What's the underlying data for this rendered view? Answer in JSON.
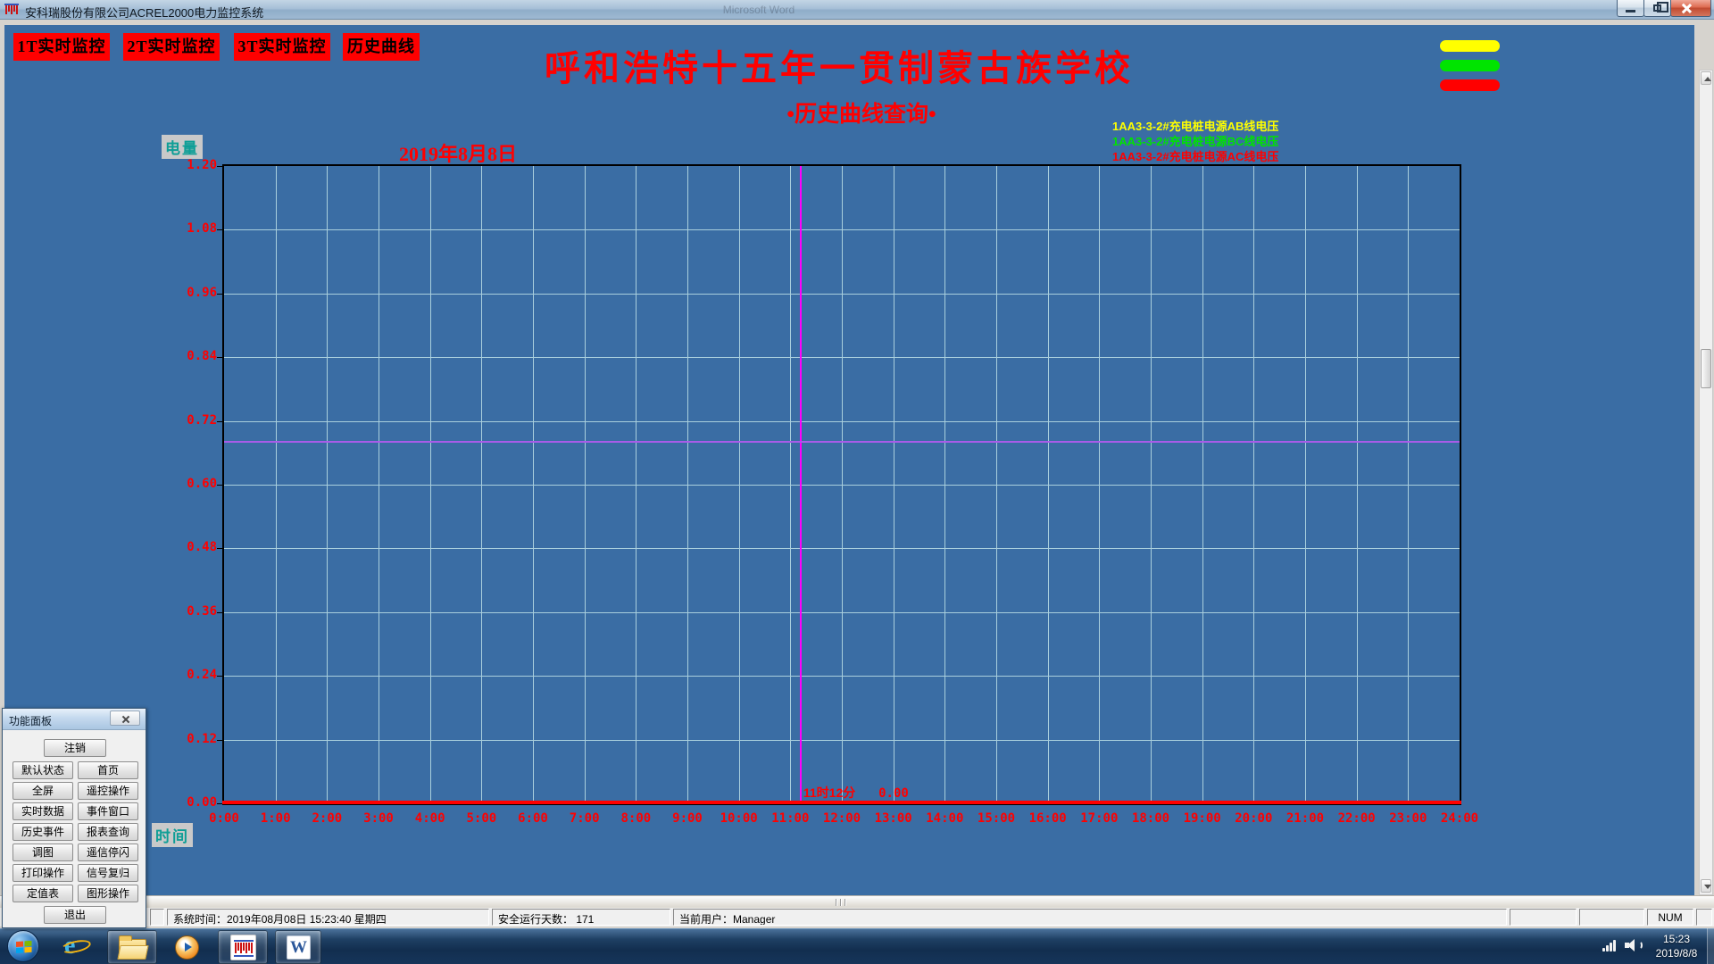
{
  "theme": {
    "background_blue": "#3A6DA4",
    "accent_red": "#FF0000",
    "grid_color": "#A9CFDD",
    "label_teal": "#0E9E96",
    "crosshair_magenta": "#FF00FF",
    "crosshair_violet": "#A85CE8"
  },
  "window": {
    "title": "安科瑞股份有限公司ACREL2000电力监控系统",
    "background_window_hint": "Microsoft Word"
  },
  "nav": {
    "buttons": [
      {
        "label": "1T实时监控"
      },
      {
        "label": "2T实时监控"
      },
      {
        "label": "3T实时监控"
      },
      {
        "label": "历史曲线"
      }
    ]
  },
  "header": {
    "school_title": "呼和浩特十五年一贯制蒙古族学校",
    "page_subtitle": "•历史曲线查询•"
  },
  "legend": {
    "items": [
      {
        "label": "1AA3-3-2#充电桩电源AB线电压",
        "color": "#FFFF00"
      },
      {
        "label": "1AA3-3-2#充电桩电源BC线电压",
        "color": "#00E400"
      },
      {
        "label": "1AA3-3-2#充电桩电源AC线电压",
        "color": "#FF0000"
      }
    ]
  },
  "indicator_pills": [
    {
      "color": "#FFFF00"
    },
    {
      "color": "#00E400"
    },
    {
      "color": "#FF0000"
    }
  ],
  "chart_data": {
    "type": "line",
    "title": "2019年8月8日",
    "ylabel": "电量",
    "xlabel": "时间",
    "ylim": [
      0.0,
      1.2
    ],
    "xlim_hours": [
      0,
      24
    ],
    "grid": true,
    "legend_position": "top-right",
    "y_ticks": [
      "1.20",
      "1.08",
      "0.96",
      "0.84",
      "0.72",
      "0.60",
      "0.48",
      "0.36",
      "0.24",
      "0.12",
      "0.00"
    ],
    "x_ticks": [
      "0:00",
      "1:00",
      "2:00",
      "3:00",
      "4:00",
      "5:00",
      "6:00",
      "7:00",
      "8:00",
      "9:00",
      "10:00",
      "11:00",
      "12:00",
      "13:00",
      "14:00",
      "15:00",
      "16:00",
      "17:00",
      "18:00",
      "19:00",
      "20:00",
      "21:00",
      "22:00",
      "23:00",
      "24:00"
    ],
    "series": [
      {
        "name": "1AA3-3-2#充电桩电源AB线电压",
        "color": "#FFFF00",
        "values": [
          [
            0,
            0.0
          ],
          [
            24,
            0.0
          ]
        ]
      },
      {
        "name": "1AA3-3-2#充电桩电源BC线电压",
        "color": "#00E400",
        "values": [
          [
            0,
            0.0
          ],
          [
            24,
            0.0
          ]
        ]
      },
      {
        "name": "1AA3-3-2#充电桩电源AC线电压",
        "color": "#FF0000",
        "values": [
          [
            0,
            0.0
          ],
          [
            24,
            0.0
          ]
        ]
      }
    ],
    "cursor": {
      "time_label": "11时12分",
      "value_label": "0.00",
      "x_hours": 11.2,
      "crosshair_y_value": 0.68
    }
  },
  "function_panel": {
    "title": "功能面板",
    "logout": "注销",
    "rows": [
      [
        "默认状态",
        "首页"
      ],
      [
        "全屏",
        "遥控操作"
      ],
      [
        "实时数据",
        "事件窗口"
      ],
      [
        "历史事件",
        "报表查询"
      ],
      [
        "调图",
        "遥信停闪"
      ],
      [
        "打印操作",
        "信号复归"
      ],
      [
        "定值表",
        "图形操作"
      ]
    ],
    "exit": "退出"
  },
  "status_bar": {
    "system_time": "系统时间：2019年08月08日  15:23:40   星期四",
    "safe_days": "安全运行天数： 171",
    "current_user": "当前用户：Manager",
    "num_lock": "NUM"
  },
  "taskbar": {
    "clock_time": "15:23",
    "clock_date": "2019/8/8"
  }
}
